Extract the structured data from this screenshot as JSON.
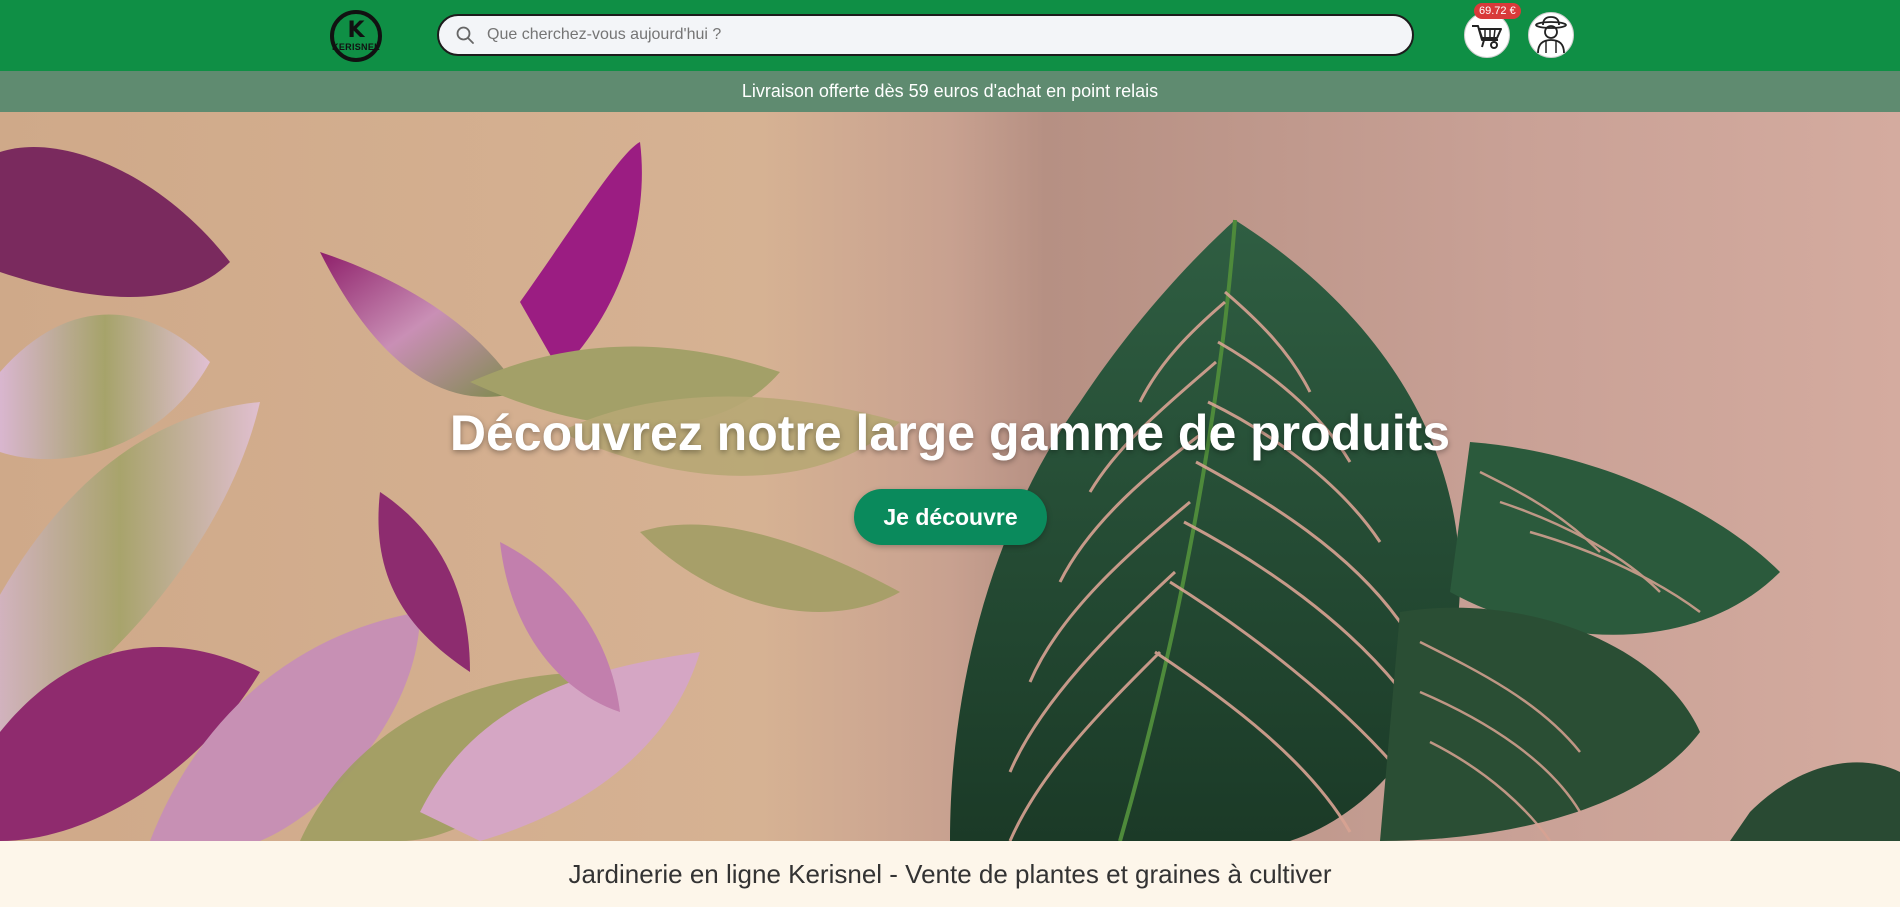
{
  "header": {
    "logo_letter": "K",
    "logo_name": "KERISNEL",
    "search": {
      "placeholder": "Que cherchez-vous aujourd'hui ?",
      "value": ""
    },
    "cart_amount": "69.72 €",
    "colors": {
      "bar": "#0f8f45",
      "badge": "#d93a3a"
    }
  },
  "promo": {
    "text": "Livraison offerte dès 59 euros d'achat en point relais"
  },
  "hero": {
    "title": "Découvrez notre large gamme de produits",
    "cta": "Je découvre",
    "cta_color": "#0a8a5c"
  },
  "section": {
    "title": "Jardinerie en ligne Kerisnel - Vente de plantes et graines à cultiver"
  },
  "icons": [
    "search-icon",
    "wheelbarrow-cart-icon",
    "gardener-avatar-icon"
  ]
}
